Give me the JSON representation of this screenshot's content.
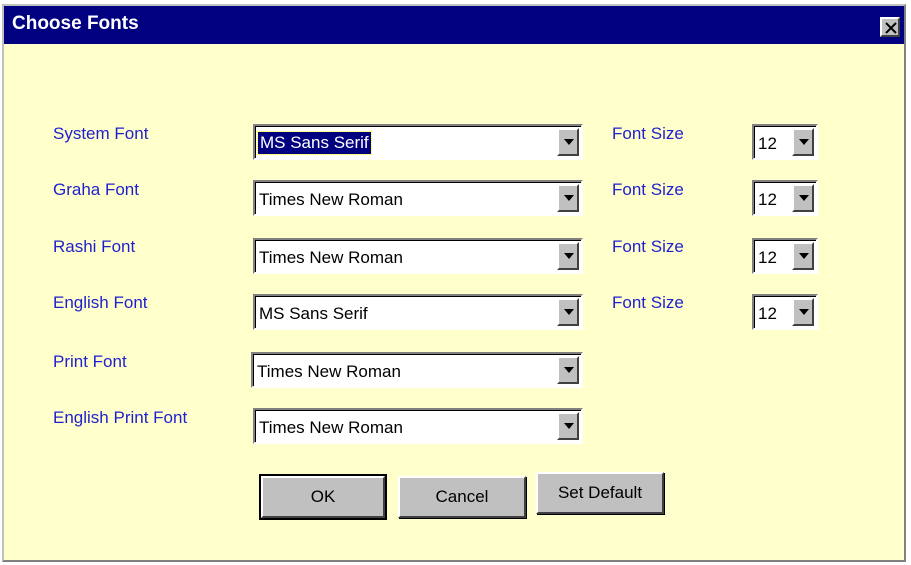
{
  "dialog": {
    "title": "Choose Fonts",
    "close_label": "close"
  },
  "rows": [
    {
      "label": "System Font",
      "font": "MS Sans Serif",
      "size_label": "Font Size",
      "size": "12"
    },
    {
      "label": "Graha Font",
      "font": "Times New Roman",
      "size_label": "Font Size",
      "size": "12"
    },
    {
      "label": "Rashi Font",
      "font": "Times New Roman",
      "size_label": "Font Size",
      "size": "12"
    },
    {
      "label": "English Font",
      "font": "MS Sans Serif",
      "size_label": "Font Size",
      "size": "12"
    },
    {
      "label": "Print Font",
      "font": "Times New Roman"
    },
    {
      "label": "English Print Font",
      "font": "Times New Roman"
    }
  ],
  "buttons": {
    "ok": "OK",
    "cancel": "Cancel",
    "set_default": "Set Default"
  },
  "colors": {
    "dialog_bg": "#ffffcc",
    "titlebar": "#000080",
    "label_text": "#1f1fcf",
    "face": "#c0c0c0"
  }
}
